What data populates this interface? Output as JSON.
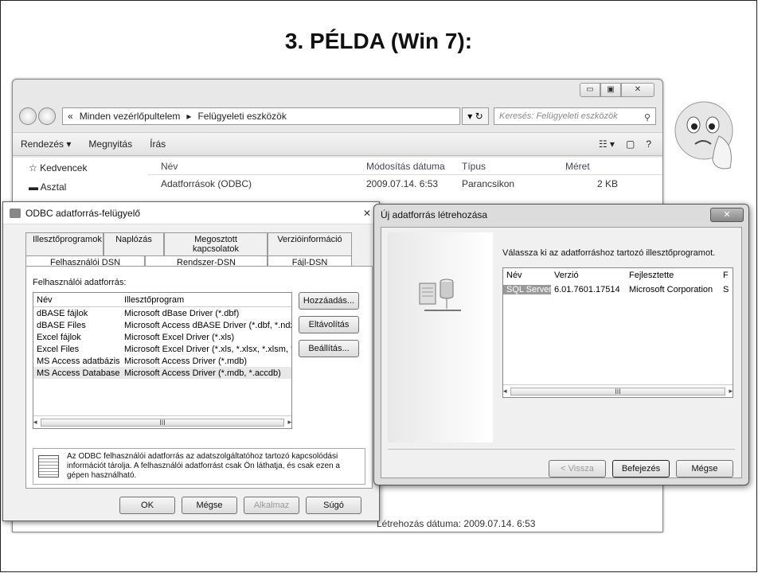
{
  "slide": {
    "title": "3. PÉLDA  (Win 7):"
  },
  "explorer": {
    "controls": [
      "▭",
      "▣",
      "✕"
    ],
    "breadcrumb": [
      "«",
      "Minden vezérlőpultelem",
      "▸",
      "Felügyeleti eszközök"
    ],
    "refresh_label": "▾  ↻",
    "search_placeholder": "Keresés: Felügyeleti eszközök",
    "toolbar": {
      "organize": "Rendezés ▾",
      "open": "Megnyitás",
      "write": "Írás"
    },
    "nav": {
      "favorites": "Kedvencek",
      "desktop": "Asztal"
    },
    "columns": {
      "name": "Név",
      "modified": "Módosítás dátuma",
      "type": "Típus",
      "size": "Méret"
    },
    "rows": [
      {
        "name": "Adatforrások (ODBC)",
        "modified": "2009.07.14. 6:53",
        "type": "Parancsikon",
        "size": "2 KB"
      }
    ],
    "status": "Létrehozás dátuma: 2009.07.14. 6:53"
  },
  "odbc": {
    "title": "ODBC adatforrás-felügyelő",
    "close": "✕",
    "tabs_row1": [
      "Illesztőprogramok",
      "Naplózás",
      "Megosztott kapcsolatok",
      "Verzióinformáció"
    ],
    "tabs_row2": [
      "Felhasználói DSN",
      "Rendszer-DSN",
      "Fájl-DSN"
    ],
    "list_label": "Felhasználói adatforrás:",
    "list_head": {
      "name": "Név",
      "driver": "Illesztőprogram"
    },
    "sources": [
      {
        "name": "dBASE fájlok",
        "driver": "Microsoft dBase Driver (*.dbf)"
      },
      {
        "name": "dBASE Files",
        "driver": "Microsoft Access dBASE Driver (*.dbf, *.ndx"
      },
      {
        "name": "Excel fájlok",
        "driver": "Microsoft Excel Driver (*.xls)"
      },
      {
        "name": "Excel Files",
        "driver": "Microsoft Excel Driver (*.xls, *.xlsx, *.xlsm, *.x"
      },
      {
        "name": "MS Access adatbázis",
        "driver": "Microsoft Access Driver (*.mdb)"
      },
      {
        "name": "MS Access Database",
        "driver": "Microsoft Access Driver (*.mdb, *.accdb)"
      }
    ],
    "side_buttons": {
      "add": "Hozzáadás...",
      "remove": "Eltávolítás",
      "config": "Beállítás..."
    },
    "info": "Az ODBC felhasználói adatforrás az adatszolgáltatóhoz tartozó kapcsolódási információt tárolja. A felhasználói adatforrást csak Ön láthatja, és csak ezen a gépen használható.",
    "buttons": {
      "ok": "OK",
      "cancel": "Mégse",
      "apply": "Alkalmaz",
      "help": "Súgó"
    }
  },
  "newds": {
    "title": "Új adatforrás létrehozása",
    "close": "✕",
    "prompt": "Válassza ki az adatforráshoz tartozó illesztőprogramot.",
    "head": {
      "name": "Név",
      "version": "Verzió",
      "developer": "Fejlesztette",
      "f": "F"
    },
    "drivers": [
      {
        "name": "SQL Server",
        "version": "6.01.7601.17514",
        "developer": "Microsoft Corporation",
        "f": "S"
      }
    ],
    "buttons": {
      "back": "< Vissza",
      "finish": "Befejezés",
      "cancel": "Mégse"
    }
  },
  "scroll_thumb": "III"
}
